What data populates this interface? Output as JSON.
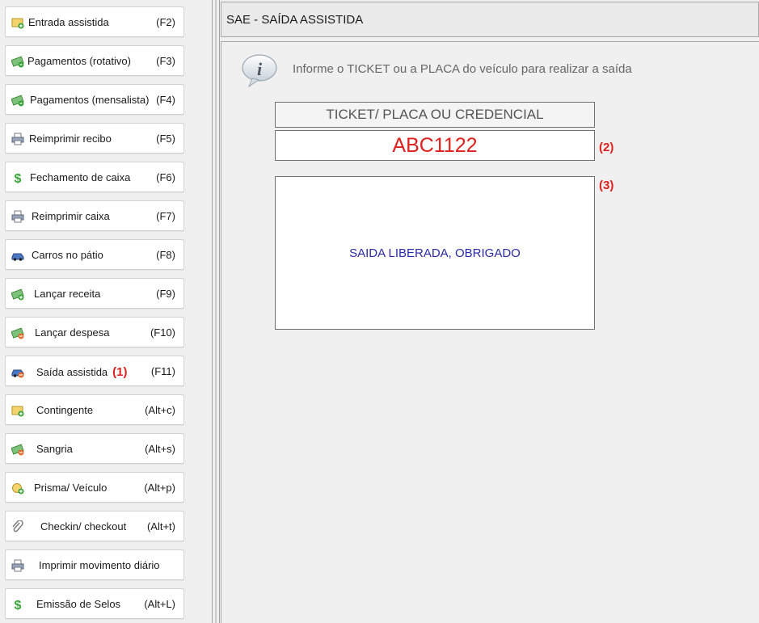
{
  "sidebar": {
    "items": [
      {
        "label": "Entrada assistida",
        "key": "(F2)",
        "icon": "ticket-add-icon",
        "mark": ""
      },
      {
        "label": "Pagamentos (rotativo)",
        "key": "(F3)",
        "icon": "money-icon",
        "mark": ""
      },
      {
        "label": "Pagamentos (mensalista)",
        "key": "(F4)",
        "icon": "money-icon",
        "mark": ""
      },
      {
        "label": "Reimprimir recibo",
        "key": "(F5)",
        "icon": "printer-icon",
        "mark": ""
      },
      {
        "label": "Fechamento de caixa",
        "key": "(F6)",
        "icon": "dollar-icon",
        "mark": ""
      },
      {
        "label": "Reimprimir caixa",
        "key": "(F7)",
        "icon": "printer-icon",
        "mark": ""
      },
      {
        "label": "Carros no pátio",
        "key": "(F8)",
        "icon": "car-icon",
        "mark": ""
      },
      {
        "label": "Lançar receita",
        "key": "(F9)",
        "icon": "money-add-icon",
        "mark": ""
      },
      {
        "label": "Lançar despesa",
        "key": "(F10)",
        "icon": "money-remove-icon",
        "mark": ""
      },
      {
        "label": "Saída assistida",
        "key": "(F11)",
        "icon": "car-exit-icon",
        "mark": "(1)"
      },
      {
        "label": "Contingente",
        "key": "(Alt+c)",
        "icon": "ticket-add-icon",
        "mark": ""
      },
      {
        "label": "Sangria",
        "key": "(Alt+s)",
        "icon": "money-remove-icon",
        "mark": ""
      },
      {
        "label": "Prisma/ Veículo",
        "key": "(Alt+p)",
        "icon": "prism-icon",
        "mark": ""
      },
      {
        "label": "Checkin/ checkout",
        "key": "(Alt+t)",
        "icon": "paperclip-icon",
        "mark": ""
      },
      {
        "label": "Imprimir movimento diário",
        "key": "",
        "icon": "printer-icon",
        "mark": ""
      },
      {
        "label": "Emissão de Selos",
        "key": "(Alt+L)",
        "icon": "dollar-icon",
        "mark": ""
      }
    ]
  },
  "header": {
    "title": "SAE - SAÍDA ASSISTIDA"
  },
  "main": {
    "info_text": "Informe o TICKET ou a PLACA do veículo para realizar a saída",
    "ticket_header": "TICKET/ PLACA OU CREDENCIAL",
    "ticket_value": "ABC1122",
    "ticket_annotation": "(2)",
    "result_text": "SAIDA LIBERADA, OBRIGADO",
    "result_annotation": "(3)"
  },
  "colors": {
    "accent_red": "#e0201c",
    "result_blue": "#2a2aa8"
  }
}
